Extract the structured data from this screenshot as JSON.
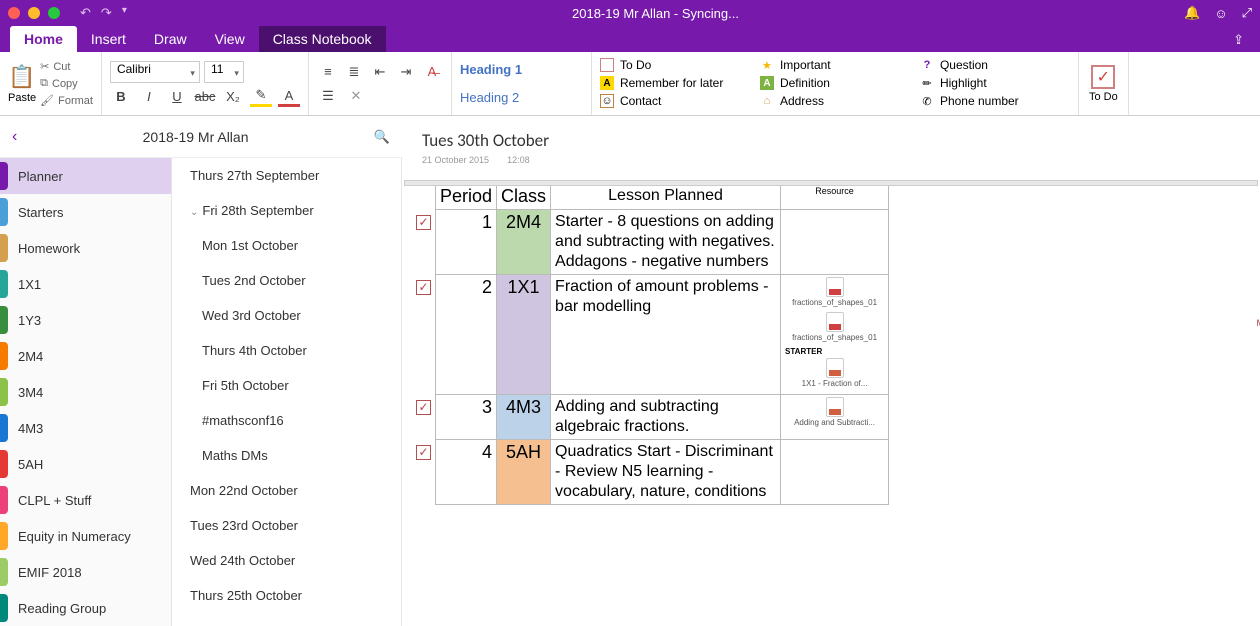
{
  "titlebar": {
    "title": "2018-19 Mr Allan - Syncing..."
  },
  "tabs": {
    "home": "Home",
    "insert": "Insert",
    "draw": "Draw",
    "view": "View",
    "class": "Class Notebook"
  },
  "ribbon": {
    "paste": "Paste",
    "cut": "Cut",
    "copy": "Copy",
    "format": "Format",
    "font": "Calibri",
    "size": "11",
    "heading1": "Heading 1",
    "heading2": "Heading 2",
    "tags": {
      "todo": "To Do",
      "important": "Important",
      "question": "Question",
      "remember": "Remember for later",
      "definition": "Definition",
      "highlight": "Highlight",
      "contact": "Contact",
      "address": "Address",
      "phone": "Phone number"
    },
    "todo_btn": "To Do"
  },
  "nav": {
    "notebook": "2018-19 Mr Allan",
    "sections": [
      {
        "label": "Planner",
        "color": "c-purple",
        "active": true
      },
      {
        "label": "Starters",
        "color": "c-blue"
      },
      {
        "label": "Homework",
        "color": "c-tan"
      },
      {
        "label": "1X1",
        "color": "c-teal"
      },
      {
        "label": "1Y3",
        "color": "c-dgreen"
      },
      {
        "label": "2M4",
        "color": "c-orange"
      },
      {
        "label": "3M4",
        "color": "c-green"
      },
      {
        "label": "4M3",
        "color": "c-dblue"
      },
      {
        "label": "5AH",
        "color": "c-red"
      },
      {
        "label": "CLPL + Stuff",
        "color": "c-pink"
      },
      {
        "label": "Equity in Numeracy",
        "color": "c-amber"
      },
      {
        "label": "EMIF 2018",
        "color": "c-lime"
      },
      {
        "label": "Reading Group",
        "color": "c-dteal"
      }
    ],
    "pages": [
      {
        "label": "Thurs 27th September",
        "indent": false
      },
      {
        "label": "Fri 28th September",
        "indent": false,
        "expand": true
      },
      {
        "label": "Mon 1st October",
        "indent": true
      },
      {
        "label": "Tues 2nd October",
        "indent": true
      },
      {
        "label": "Wed 3rd October",
        "indent": true
      },
      {
        "label": "Thurs 4th October",
        "indent": true
      },
      {
        "label": "Fri 5th October",
        "indent": true
      },
      {
        "label": "#mathsconf16",
        "indent": true
      },
      {
        "label": "Maths DMs",
        "indent": true
      },
      {
        "label": "Mon 22nd October",
        "indent": false
      },
      {
        "label": "Tues 23rd October",
        "indent": false
      },
      {
        "label": "Wed 24th October",
        "indent": false
      },
      {
        "label": "Thurs 25th October",
        "indent": false
      }
    ]
  },
  "page": {
    "title": "Tues 30th October",
    "date": "21 October 2015",
    "time": "12:08",
    "initials": "MA",
    "headers": {
      "period": "Period",
      "class": "Class",
      "lesson": "Lesson Planned",
      "resource": "Resource"
    },
    "rows": [
      {
        "period": "1",
        "class": "2M4",
        "bg": "bg-green",
        "lesson": "Starter - 8 questions on adding and subtracting with negatives.\nAddagons - negative numbers",
        "resources": []
      },
      {
        "period": "2",
        "class": "1X1",
        "bg": "bg-lilac",
        "lesson": "Fraction of amount problems - bar modelling",
        "resources": [
          {
            "type": "pdf",
            "name": "fractions_of_shapes_01"
          },
          {
            "type": "pdf",
            "name": "fractions_of_shapes_01"
          },
          {
            "type": "text",
            "name": "STARTER"
          },
          {
            "type": "ppt",
            "name": "1X1 - Fraction of..."
          }
        ]
      },
      {
        "period": "3",
        "class": "4M3",
        "bg": "bg-blue",
        "lesson": "Adding and subtracting algebraic fractions.",
        "resources": [
          {
            "type": "ppt",
            "name": "Adding and Subtracti..."
          }
        ]
      },
      {
        "period": "4",
        "class": "5AH",
        "bg": "bg-orange",
        "lesson": "Quadratics Start - Discriminant - Review N5 learning - vocabulary, nature, conditions",
        "resources": []
      }
    ]
  }
}
